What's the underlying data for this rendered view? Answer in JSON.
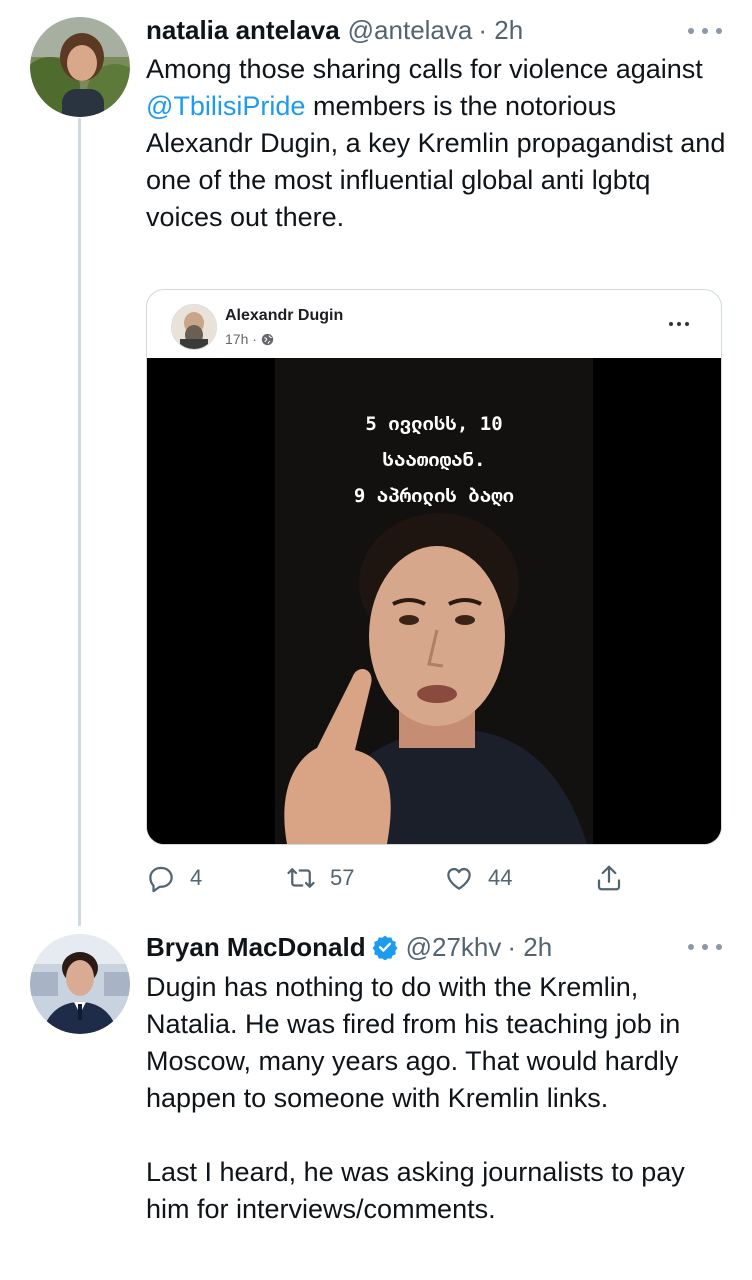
{
  "tweets": [
    {
      "author_name": "natalia antelava",
      "handle": "@antelava",
      "time": "· 2h",
      "text_before_mention": "Among those sharing calls for violence against ",
      "mention": "@TbilisiPride",
      "text_after_mention": " members is the notorious Alexandr Dugin, a key Kremlin propagandist and one of the most influential global anti lgbtq voices out there.",
      "embed": {
        "author_name": "Alexandr Dugin",
        "time": "17h ·",
        "video_caption_lines": [
          "5 ივლისს, 10",
          "საათიდან.",
          "9 აპრილის ბაღი"
        ]
      },
      "stats": {
        "replies": "4",
        "retweets": "57",
        "likes": "44"
      }
    },
    {
      "author_name": "Bryan MacDonald",
      "verified": true,
      "handle": "@27khv",
      "time": "· 2h",
      "paragraph1": "Dugin has nothing to do with the Kremlin, Natalia. He was fired from his teaching job in Moscow, many years ago. That would hardly happen to someone with Kremlin links.",
      "paragraph2": "Last I heard, he was asking journalists to pay him for interviews/comments."
    }
  ],
  "icons": {
    "reply": "speech-bubble-icon",
    "retweet": "retweet-arrows-icon",
    "like": "heart-icon",
    "share": "share-upload-icon",
    "more": "more-dots-icon",
    "verified": "verified-badge-icon",
    "globe": "globe-icon"
  },
  "colors": {
    "text": "#0f1419",
    "secondary": "#536471",
    "link": "#1d9bf0",
    "verified": "#1d9bf0",
    "thread_line": "#cfd9de"
  }
}
